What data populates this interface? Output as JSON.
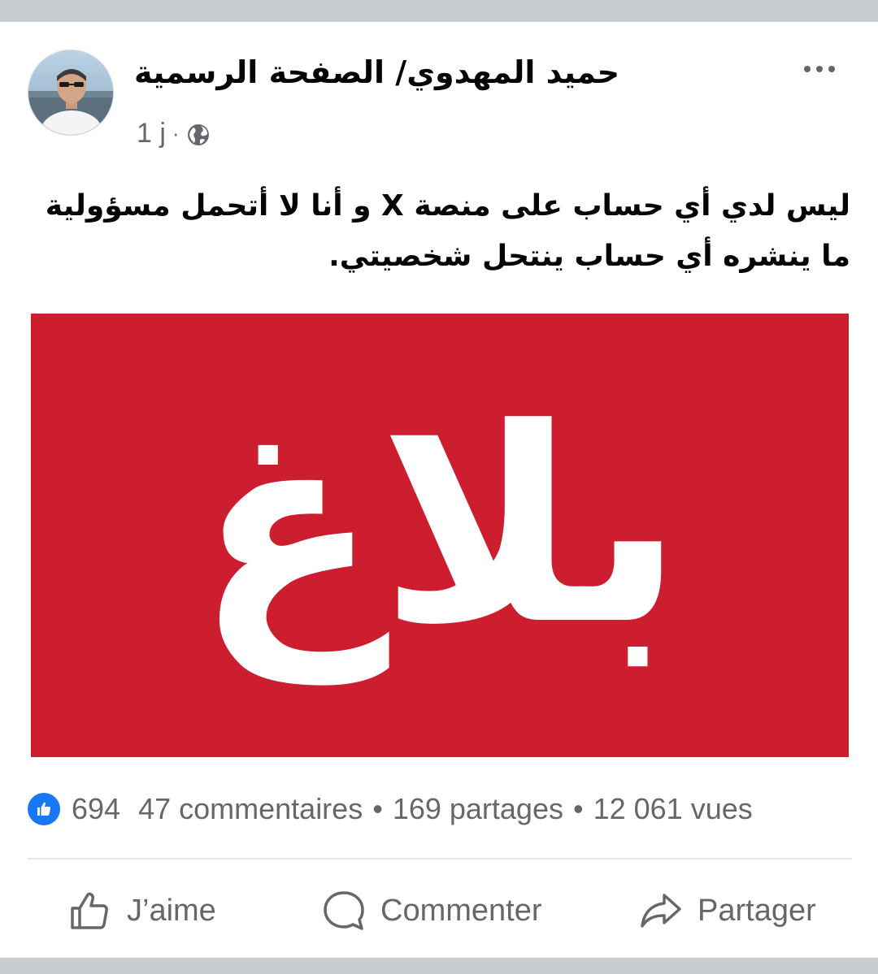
{
  "post": {
    "page_name": "حميد المهدوي/ الصفحة الرسمية",
    "time": "1 j",
    "meta_separator": "·",
    "privacy_icon": "globe-icon",
    "more_icon": "more-options-icon",
    "text": "ليس لدي أي حساب على منصة X و أنا لا أتحمل مسؤولية ما ينشره أي حساب ينتحل شخصيتي.",
    "banner": {
      "text": "بلاغ",
      "background": "#cc1e2e",
      "text_color": "#ffffff"
    }
  },
  "stats": {
    "reaction_icon": "like-reaction-icon",
    "reactions": "694",
    "comments": "47 commentaires",
    "shares": "169 partages",
    "views": "12 061 vues",
    "separator": "•"
  },
  "actions": {
    "like_label": "J’aime",
    "comment_label": "Commenter",
    "share_label": "Partager"
  },
  "colors": {
    "accent": "#1877f2",
    "secondary_text": "#65676b",
    "primary_text": "#050505",
    "frame": "#c9ccd1"
  }
}
